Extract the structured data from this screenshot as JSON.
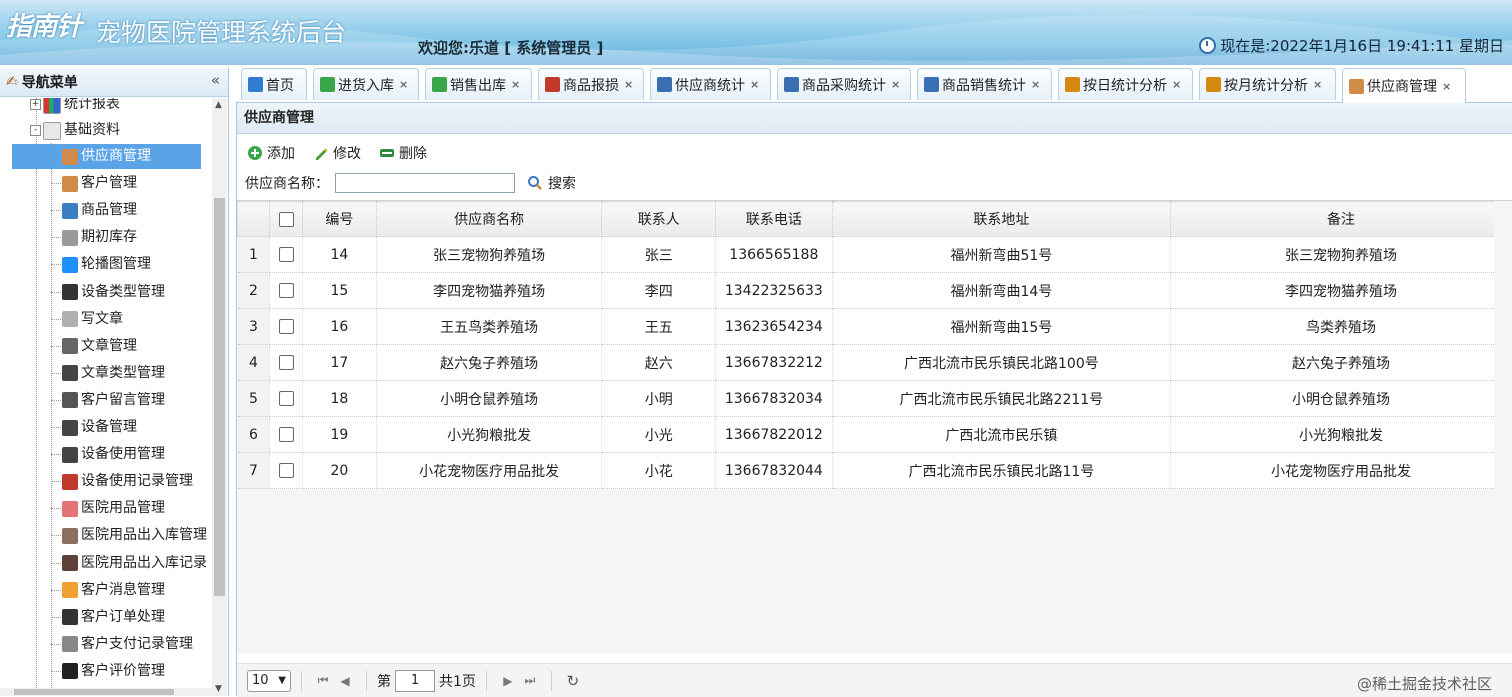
{
  "header": {
    "logo_text": "指南针",
    "app_title": "宠物医院管理系统后台",
    "welcome": "欢迎您:乐道 [ 系统管理员 ]",
    "datetime": "现在是:2022年1月16日 19:41:11 星期日"
  },
  "sidebar": {
    "title": "导航菜单",
    "collapse_icon": "«",
    "groups": [
      {
        "label": "统计报表",
        "expander": "+"
      },
      {
        "label": "基础资料",
        "expander": "-"
      }
    ],
    "items": [
      {
        "label": "供应商管理",
        "icon_color": "#d08a4a",
        "selected": true
      },
      {
        "label": "客户管理",
        "icon_color": "#d08a4a"
      },
      {
        "label": "商品管理",
        "icon_color": "#3a7fc0"
      },
      {
        "label": "期初库存",
        "icon_color": "#9a9a9a"
      },
      {
        "label": "轮播图管理",
        "icon_color": "#1e90ff"
      },
      {
        "label": "设备类型管理",
        "icon_color": "#333333"
      },
      {
        "label": "写文章",
        "icon_color": "#b0b0b0"
      },
      {
        "label": "文章管理",
        "icon_color": "#666666"
      },
      {
        "label": "文章类型管理",
        "icon_color": "#444444"
      },
      {
        "label": "客户留言管理",
        "icon_color": "#555555"
      },
      {
        "label": "设备管理",
        "icon_color": "#444444"
      },
      {
        "label": "设备使用管理",
        "icon_color": "#444444"
      },
      {
        "label": "设备使用记录管理",
        "icon_color": "#c0392b"
      },
      {
        "label": "医院用品管理",
        "icon_color": "#e57373"
      },
      {
        "label": "医院用品出入库管理",
        "icon_color": "#8d6e63"
      },
      {
        "label": "医院用品出入库记录",
        "icon_color": "#5d4037"
      },
      {
        "label": "客户消息管理",
        "icon_color": "#f0a030"
      },
      {
        "label": "客户订单处理",
        "icon_color": "#333333"
      },
      {
        "label": "客户支付记录管理",
        "icon_color": "#888888"
      },
      {
        "label": "客户评价管理",
        "icon_color": "#222222"
      }
    ]
  },
  "tabs": [
    {
      "label": "首页",
      "icon": "home-icon",
      "closable": false
    },
    {
      "label": "进货入库",
      "icon": "import-icon",
      "closable": true
    },
    {
      "label": "销售出库",
      "icon": "export-icon",
      "closable": true
    },
    {
      "label": "商品报损",
      "icon": "damage-icon",
      "closable": true
    },
    {
      "label": "供应商统计",
      "icon": "chart-icon",
      "closable": true
    },
    {
      "label": "商品采购统计",
      "icon": "chart-icon",
      "closable": true
    },
    {
      "label": "商品销售统计",
      "icon": "chart-icon",
      "closable": true
    },
    {
      "label": "按日统计分析",
      "icon": "report-icon",
      "closable": true
    },
    {
      "label": "按月统计分析",
      "icon": "report-icon",
      "closable": true
    },
    {
      "label": "供应商管理",
      "icon": "user-icon",
      "closable": true,
      "active": true
    }
  ],
  "close_glyph": "×",
  "panel": {
    "title": "供应商管理",
    "toolbar": {
      "add": "添加",
      "edit": "修改",
      "delete": "删除"
    },
    "search": {
      "label": "供应商名称：",
      "value": "",
      "button": "搜索"
    }
  },
  "grid": {
    "columns": [
      "编号",
      "供应商名称",
      "联系人",
      "联系电话",
      "联系地址",
      "备注"
    ],
    "rows": [
      {
        "n": "1",
        "id": "14",
        "name": "张三宠物狗养殖场",
        "contact": "张三",
        "phone": "1366565188",
        "address": "福州新弯曲51号",
        "remark": "张三宠物狗养殖场"
      },
      {
        "n": "2",
        "id": "15",
        "name": "李四宠物猫养殖场",
        "contact": "李四",
        "phone": "13422325633",
        "address": "福州新弯曲14号",
        "remark": "李四宠物猫养殖场"
      },
      {
        "n": "3",
        "id": "16",
        "name": "王五鸟类养殖场",
        "contact": "王五",
        "phone": "13623654234",
        "address": "福州新弯曲15号",
        "remark": "鸟类养殖场"
      },
      {
        "n": "4",
        "id": "17",
        "name": "赵六兔子养殖场",
        "contact": "赵六",
        "phone": "13667832212",
        "address": "广西北流市民乐镇民北路100号",
        "remark": "赵六兔子养殖场"
      },
      {
        "n": "5",
        "id": "18",
        "name": "小明仓鼠养殖场",
        "contact": "小明",
        "phone": "13667832034",
        "address": "广西北流市民乐镇民北路2211号",
        "remark": "小明仓鼠养殖场"
      },
      {
        "n": "6",
        "id": "19",
        "name": "小光狗粮批发",
        "contact": "小光",
        "phone": "13667822012",
        "address": "广西北流市民乐镇",
        "remark": "小光狗粮批发"
      },
      {
        "n": "7",
        "id": "20",
        "name": "小花宠物医疗用品批发",
        "contact": "小花",
        "phone": "13667832044",
        "address": "广西北流市民乐镇民北路11号",
        "remark": "小花宠物医疗用品批发"
      }
    ]
  },
  "pager": {
    "page_size": "10",
    "page_prefix": "第",
    "page_value": "1",
    "page_total": "共1页"
  },
  "watermark": "@稀土掘金技术社区"
}
